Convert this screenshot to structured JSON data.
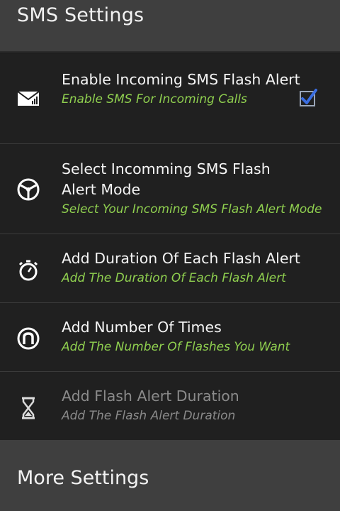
{
  "header": {
    "title": "SMS Settings"
  },
  "items": [
    {
      "label": "Enable Incoming SMS Flash Alert",
      "sublabel": "Enable SMS For Incoming Calls",
      "icon": "mail-icon",
      "checked": true,
      "enabled": true
    },
    {
      "label": "Select Incomming SMS Flash Alert Mode",
      "sublabel": "Select Your Incoming SMS Flash Alert Mode",
      "icon": "steering-wheel-icon",
      "enabled": true
    },
    {
      "label": "Add Duration Of Each Flash Alert",
      "sublabel": "Add The Duration Of Each Flash Alert",
      "icon": "stopwatch-icon",
      "enabled": true
    },
    {
      "label": "Add Number Of Times",
      "sublabel": "Add The Number Of Flashes You Want",
      "icon": "circled-n-icon",
      "enabled": true
    },
    {
      "label": "Add Flash Alert Duration",
      "sublabel": "Add The Flash Alert Duration",
      "icon": "hourglass-icon",
      "enabled": false
    }
  ],
  "footer": {
    "title": "More Settings"
  },
  "colors": {
    "accent": "#3a6de0",
    "sublabel": "#8fcf4f",
    "disabled": "#8a8a8a"
  }
}
